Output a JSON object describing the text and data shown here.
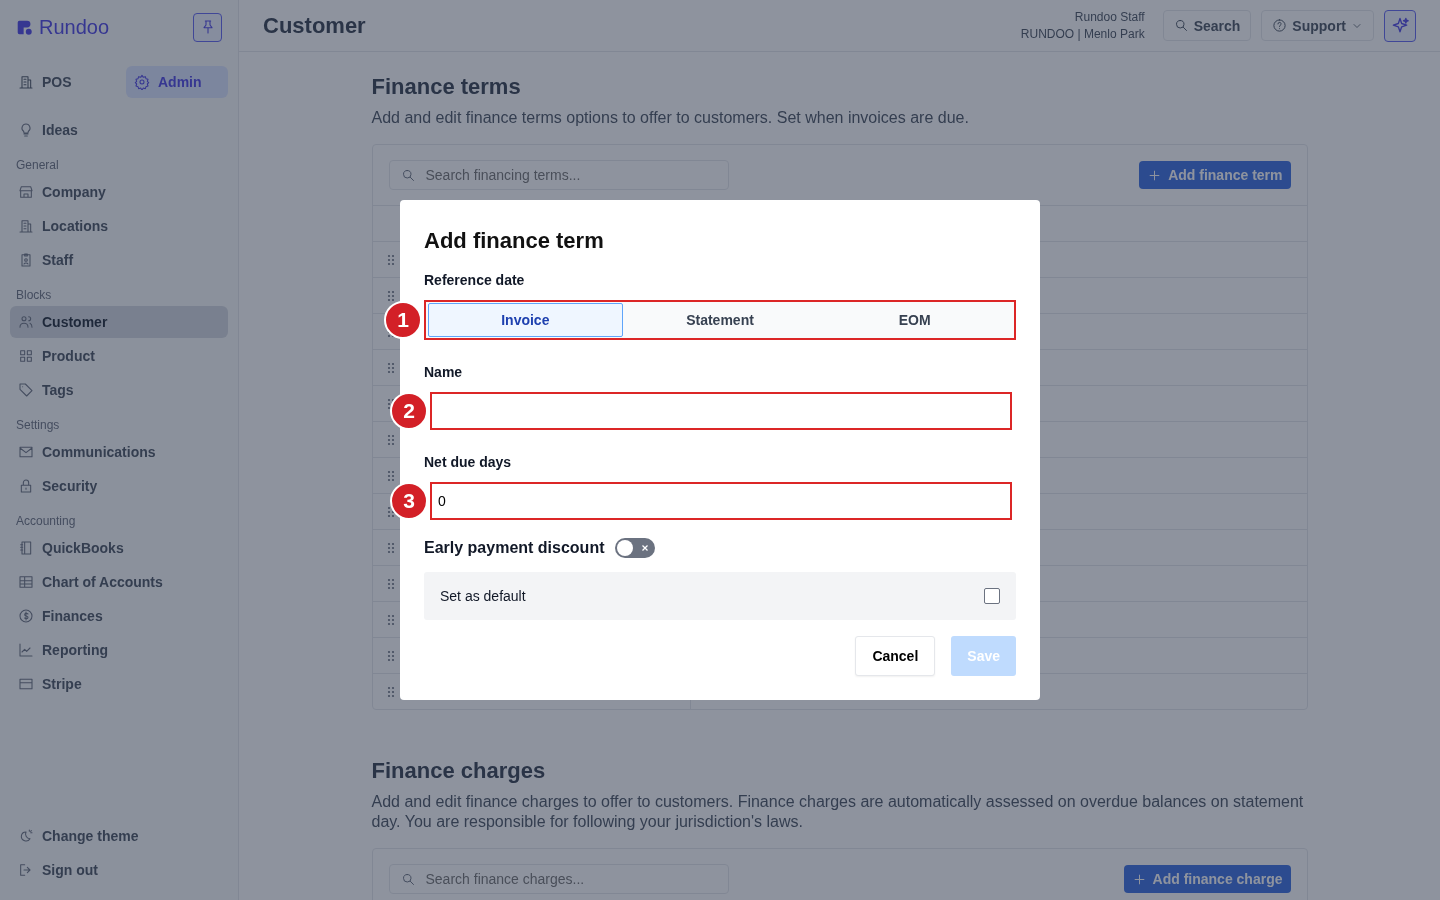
{
  "sidebar": {
    "brand": "Rundoo",
    "modes": [
      {
        "label": "POS",
        "selected": false
      },
      {
        "label": "Admin",
        "selected": true
      }
    ],
    "top_items": [
      {
        "label": "Ideas",
        "selected": false
      }
    ],
    "sections": [
      {
        "heading": "General",
        "items": [
          {
            "label": "Company",
            "selected": false
          },
          {
            "label": "Locations",
            "selected": false
          },
          {
            "label": "Staff",
            "selected": false
          }
        ]
      },
      {
        "heading": "Blocks",
        "items": [
          {
            "label": "Customer",
            "selected": true
          },
          {
            "label": "Product",
            "selected": false
          },
          {
            "label": "Tags",
            "selected": false
          }
        ]
      },
      {
        "heading": "Settings",
        "items": [
          {
            "label": "Communications",
            "selected": false
          },
          {
            "label": "Security",
            "selected": false
          }
        ]
      },
      {
        "heading": "Accounting",
        "items": [
          {
            "label": "QuickBooks",
            "selected": false
          },
          {
            "label": "Chart of Accounts",
            "selected": false
          },
          {
            "label": "Finances",
            "selected": false
          },
          {
            "label": "Reporting",
            "selected": false
          },
          {
            "label": "Stripe",
            "selected": false
          }
        ]
      }
    ],
    "footer_items": [
      "Change theme",
      "Sign out"
    ]
  },
  "header": {
    "title": "Customer",
    "user_name": "Rundoo Staff",
    "user_location": "RUNDOO | Menlo Park",
    "search_label": "Search",
    "support_label": "Support"
  },
  "finance_terms": {
    "title": "Finance terms",
    "description": "Add and edit finance terms options to offer to customers. Set when invoices are due.",
    "search_placeholder": "Search financing terms...",
    "add_button": "Add finance term"
  },
  "finance_charges": {
    "title": "Finance charges",
    "description": "Add and edit finance charges to offer to customers. Finance charges are automatically assessed on overdue balances on statement day. You are responsible for following your jurisdiction's laws.",
    "search_placeholder": "Search finance charges...",
    "add_button": "Add finance charge"
  },
  "dialog": {
    "title": "Add finance term",
    "reference_label": "Reference date",
    "reference_options": [
      {
        "label": "Invoice",
        "selected": true
      },
      {
        "label": "Statement",
        "selected": false
      },
      {
        "label": "EOM",
        "selected": false
      }
    ],
    "name_label": "Name",
    "net_days_label": "Net due days",
    "net_days_value": "0",
    "early_discount": {
      "label": "Early payment discount",
      "on": false
    },
    "default_option": {
      "label": "Set as default",
      "checked": false
    },
    "cancel_label": "Cancel",
    "save": {
      "label": "Save",
      "disabled": true
    }
  },
  "callouts": [
    {
      "label": "1"
    },
    {
      "label": "2"
    },
    {
      "label": "3"
    }
  ]
}
